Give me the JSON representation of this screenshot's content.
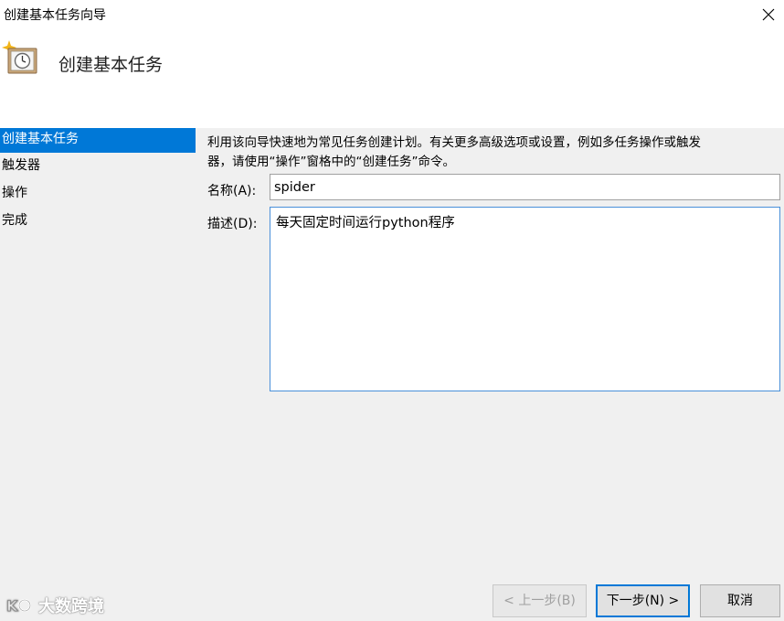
{
  "window": {
    "title": "创建基本任务向导",
    "close_icon": "close-icon"
  },
  "header": {
    "heading": "创建基本任务",
    "icon": "scheduled-task-clock-icon"
  },
  "nav": {
    "items": [
      {
        "label": "创建基本任务",
        "selected": true
      },
      {
        "label": "触发器",
        "selected": false
      },
      {
        "label": "操作",
        "selected": false
      },
      {
        "label": "完成",
        "selected": false
      }
    ]
  },
  "form": {
    "intro_line1": "利用该向导快速地为常见任务创建计划。有关更多高级选项或设置，例如多任务操作或触发",
    "intro_line2": "器，请使用“操作”窗格中的“创建任务”命令。",
    "name_label": "名称(A):",
    "name_value": "spider",
    "desc_label": "描述(D):",
    "desc_value": "每天固定时间运行python程序"
  },
  "buttons": {
    "back": "< 上一步(B)",
    "next": "下一步(N) >",
    "cancel": "取消"
  },
  "watermark": {
    "text": "大数跨境"
  },
  "colors": {
    "accent": "#0078d7",
    "panel_bg": "#f0f0f0",
    "header_bg": "#ffffff"
  }
}
